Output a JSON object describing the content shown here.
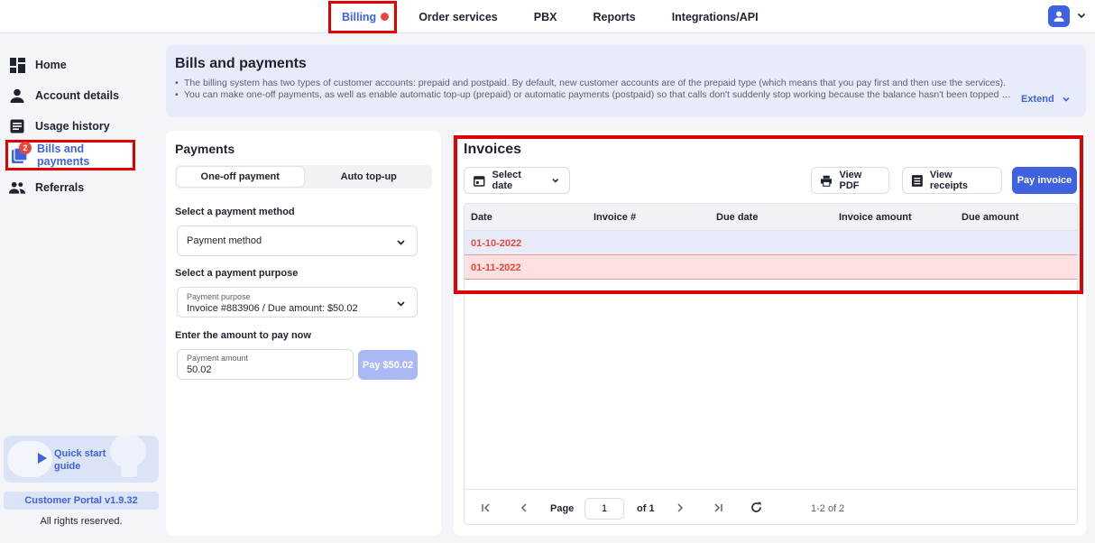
{
  "topnav": {
    "tabs": [
      {
        "label": "Billing",
        "active": true
      },
      {
        "label": "Order services"
      },
      {
        "label": "PBX"
      },
      {
        "label": "Reports"
      },
      {
        "label": "Integrations/API"
      }
    ]
  },
  "sidebar": {
    "items": [
      {
        "label": "Home",
        "icon": "dashboard-icon"
      },
      {
        "label": "Account details",
        "icon": "person-icon"
      },
      {
        "label": "Usage history",
        "icon": "document-icon"
      },
      {
        "label": "Bills and payments",
        "icon": "bills-icon",
        "badge": "2",
        "active": true
      },
      {
        "label": "Referrals",
        "icon": "group-icon"
      }
    ],
    "quick_start": "Quick start guide",
    "version": "Customer Portal v1.9.32",
    "rights": "All rights reserved."
  },
  "header": {
    "title": "Bills and payments",
    "bullets": [
      "The billing system has two types of customer accounts: prepaid and postpaid. By default, new customer accounts are of the prepaid type (which means that you pay first and then use the services).",
      "You can make one-off payments, as well as enable automatic top-up (prepaid) or automatic payments (postpaid) so that calls don't suddenly stop working because the balance hasn't been topped up."
    ],
    "extend_label": "Extend"
  },
  "payments": {
    "title": "Payments",
    "tabs": [
      "One-off payment",
      "Auto top-up"
    ],
    "method_label": "Select a payment method",
    "method_value": "Payment method",
    "purpose_label": "Select a payment purpose",
    "purpose_small": "Payment purpose",
    "purpose_value": "Invoice #883906 / Due amount: $50.02",
    "amount_label": "Enter the amount to pay now",
    "amount_small": "Payment amount",
    "amount_value": "50.02",
    "pay_button": "Pay $50.02"
  },
  "invoices": {
    "title": "Invoices",
    "select_date": "Select date",
    "view_pdf": "View PDF",
    "view_receipts": "View receipts",
    "pay_invoice": "Pay invoice",
    "columns": [
      "Date",
      "Invoice #",
      "Due amount",
      "Invoice amount",
      "Due date"
    ],
    "rows": [
      {
        "date": "01-10-2022"
      },
      {
        "date": "01-11-2022"
      }
    ],
    "pager": {
      "page_label": "Page",
      "page_value": "1",
      "of_label": "of 1",
      "range": "1-2 of 2"
    }
  },
  "colors": {
    "accent": "#3f63e0",
    "highlight": "#e00000",
    "danger": "#e8463b"
  }
}
